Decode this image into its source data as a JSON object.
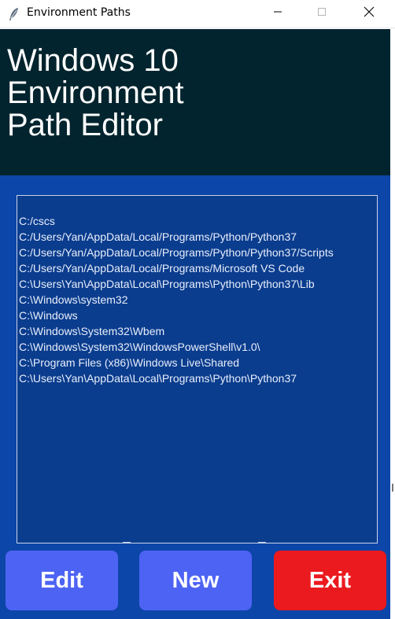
{
  "window": {
    "title": "Environment Paths",
    "icon": "feather-icon",
    "controls": [
      "minimize-icon",
      "maximize-icon",
      "close-icon"
    ]
  },
  "header": {
    "title": "Windows 10\nEnvironment\nPath Editor"
  },
  "paths": [
    "C:/cscs",
    "C:/Users/Yan/AppData/Local/Programs/Python/Python37",
    "C:/Users/Yan/AppData/Local/Programs/Python/Python37/Scripts",
    "C:/Users/Yan/AppData/Local/Programs/Microsoft VS Code",
    "C:\\Users\\Yan\\AppData\\Local\\Programs\\Python\\Python37\\Lib",
    "C:\\Windows\\system32",
    "C:\\Windows",
    "C:\\Windows\\System32\\Wbem",
    "C:\\Windows\\System32\\WindowsPowerShell\\v1.0\\",
    "C:\\Program Files (x86)\\Windows Live\\Shared",
    "C:\\Users\\Yan\\AppData\\Local\\Programs\\Python\\Python37"
  ],
  "buttons": {
    "edit": "Edit",
    "new": "New",
    "exit": "Exit"
  },
  "colors": {
    "header_bg": "#02242e",
    "body_bg": "#0c46a8",
    "list_bg": "#0b3d8e",
    "button_blue": "#4d63f4",
    "button_red": "#ea1a1f"
  }
}
